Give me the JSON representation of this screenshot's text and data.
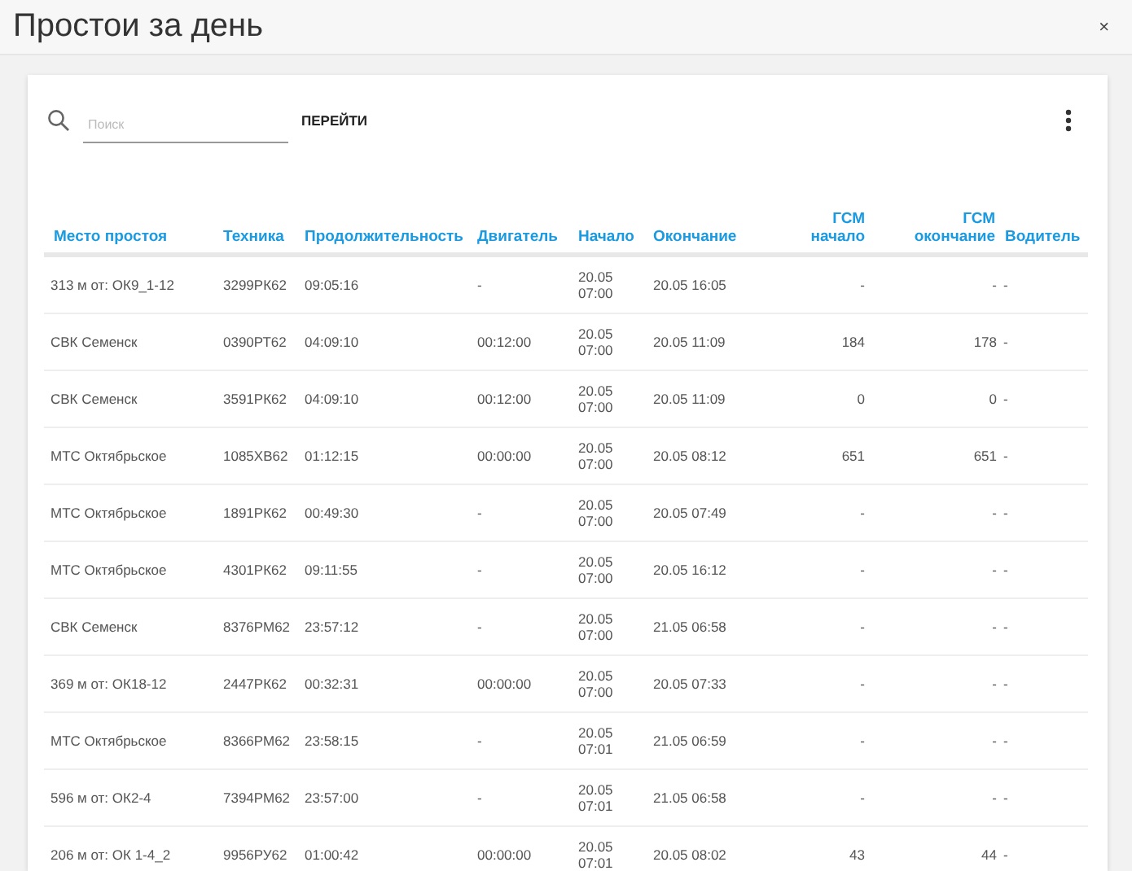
{
  "window": {
    "title": "Простои за день",
    "close": "×"
  },
  "toolbar": {
    "search": {
      "placeholder": "Поиск"
    },
    "go_button": "ПЕРЕЙТИ"
  },
  "table": {
    "columns": [
      "Место простоя",
      "Техника",
      "Продолжительность",
      "Двигатель",
      "Начало",
      "Окончание",
      "ГСМ начало",
      "ГСМ окончание",
      "Водитель"
    ],
    "rows": [
      [
        "313 м от: ОК9_1-12",
        "3299РК62",
        "09:05:16",
        "-",
        "20.05 07:00",
        "20.05 16:05",
        "-",
        "-",
        "-"
      ],
      [
        "СВК Семенск",
        "0390РТ62",
        "04:09:10",
        "00:12:00",
        "20.05 07:00",
        "20.05 11:09",
        "184",
        "178",
        "-"
      ],
      [
        "СВК Семенск",
        "3591РК62",
        "04:09:10",
        "00:12:00",
        "20.05 07:00",
        "20.05 11:09",
        "0",
        "0",
        "-"
      ],
      [
        "МТС Октябрьское",
        "1085ХВ62",
        "01:12:15",
        "00:00:00",
        "20.05 07:00",
        "20.05 08:12",
        "651",
        "651",
        "-"
      ],
      [
        "МТС Октябрьское",
        "1891РК62",
        "00:49:30",
        "-",
        "20.05 07:00",
        "20.05 07:49",
        "-",
        "-",
        "-"
      ],
      [
        "МТС Октябрьское",
        "4301РК62",
        "09:11:55",
        "-",
        "20.05 07:00",
        "20.05 16:12",
        "-",
        "-",
        "-"
      ],
      [
        "СВК Семенск",
        "8376РМ62",
        "23:57:12",
        "-",
        "20.05 07:00",
        "21.05 06:58",
        "-",
        "-",
        "-"
      ],
      [
        "369 м от: ОК18-12",
        "2447РК62",
        "00:32:31",
        "00:00:00",
        "20.05 07:00",
        "20.05 07:33",
        "-",
        "-",
        "-"
      ],
      [
        "МТС Октябрьское",
        "8366РМ62",
        "23:58:15",
        "-",
        "20.05 07:01",
        "21.05 06:59",
        "-",
        "-",
        "-"
      ],
      [
        "596 м от: ОК2-4",
        "7394РМ62",
        "23:57:00",
        "-",
        "20.05 07:01",
        "21.05 06:58",
        "-",
        "-",
        "-"
      ],
      [
        "206 м от: ОК 1-4_2",
        "9956РУ62",
        "01:00:42",
        "00:00:00",
        "20.05 07:01",
        "20.05 08:02",
        "43",
        "44",
        "-"
      ]
    ]
  }
}
